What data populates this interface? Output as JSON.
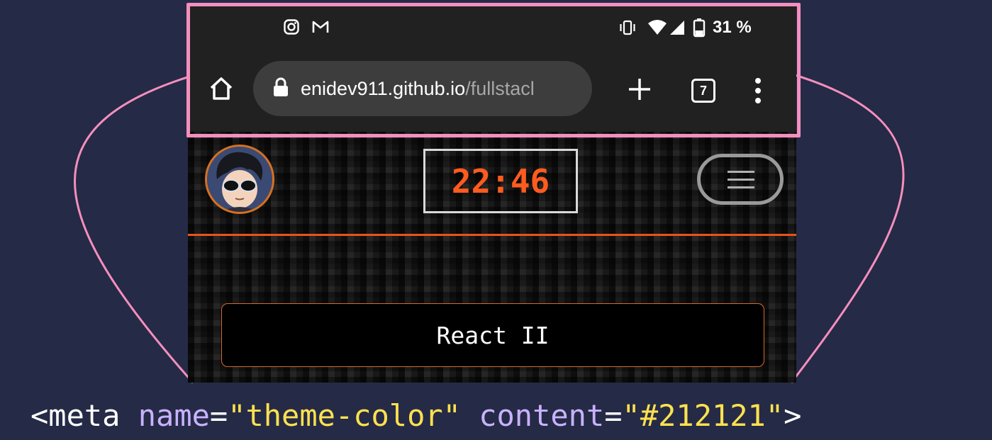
{
  "status_bar": {
    "left_icons": [
      "instagram-icon",
      "gmail-icon"
    ],
    "right_icons": [
      "vibrate-icon",
      "wifi-icon",
      "signal-icon",
      "battery-icon"
    ],
    "battery_text": "31 %"
  },
  "browser": {
    "url_host": "enidev911.github.io",
    "url_path": "/fullstacl",
    "tab_count": "7",
    "icons": [
      "home-icon",
      "lock-icon",
      "plus-icon",
      "tabs-icon",
      "more-icon"
    ]
  },
  "site": {
    "clock": "22:46",
    "course_button": "React II",
    "colors": {
      "accent": "#e8541a",
      "clock": "#ff5b1e"
    }
  },
  "annotation": {
    "open": "<",
    "tag": "meta",
    "attr1": "name",
    "eq1": "=",
    "val1": "\"theme-color\"",
    "attr2": "content",
    "eq2": "=",
    "val2": "\"#212121\"",
    "close": ">"
  },
  "colors": {
    "background": "#252a46",
    "frame": "#f48fbe",
    "browser_chrome": "#212121"
  }
}
